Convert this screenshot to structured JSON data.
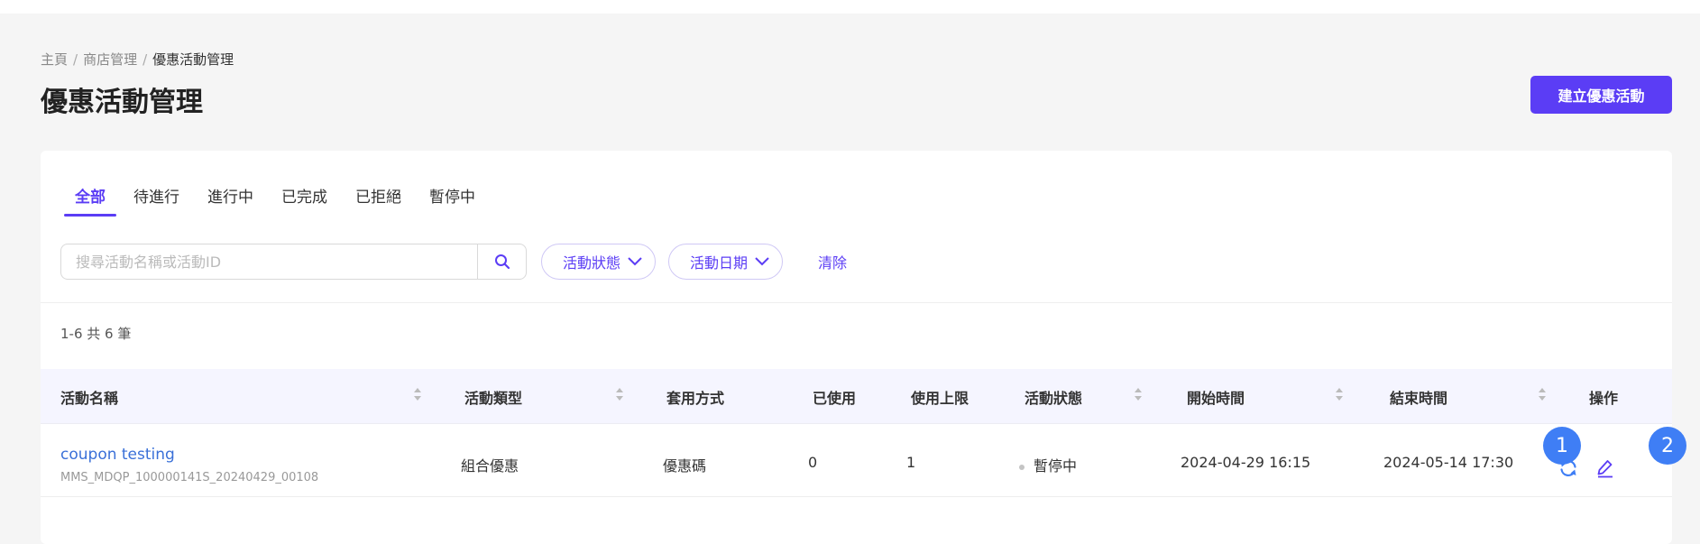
{
  "breadcrumb": {
    "items": [
      "主頁",
      "商店管理"
    ],
    "current": "優惠活動管理",
    "separator": "/"
  },
  "page": {
    "title": "優惠活動管理",
    "create_button": "建立優惠活動"
  },
  "tabs": [
    {
      "label": "全部",
      "active": true
    },
    {
      "label": "待進行",
      "active": false
    },
    {
      "label": "進行中",
      "active": false
    },
    {
      "label": "已完成",
      "active": false
    },
    {
      "label": "已拒絕",
      "active": false
    },
    {
      "label": "暫停中",
      "active": false
    }
  ],
  "filters": {
    "search_placeholder": "搜尋活動名稱或活動ID",
    "search_value": "",
    "status_filter": "活動狀態",
    "date_filter": "活動日期",
    "clear_label": "清除"
  },
  "result_count": "1-6 共 6 筆",
  "table": {
    "headers": [
      "活動名稱",
      "活動類型",
      "套用方式",
      "已使用",
      "使用上限",
      "活動狀態",
      "開始時間",
      "結束時間",
      "操作"
    ],
    "rows": [
      {
        "name": "coupon testing",
        "id": "MMS_MDQP_100000141S_20240429_00108",
        "type": "組合優惠",
        "method": "優惠碼",
        "used": "0",
        "limit": "1",
        "status": "暫停中",
        "start": "2024-04-29 16:15",
        "end": "2024-05-14 17:30"
      }
    ]
  },
  "annotations": [
    "1",
    "2"
  ],
  "colors": {
    "accent": "#5b3df5",
    "link": "#3a70d8",
    "badge": "#3f7ef5",
    "header_bg": "#f5f5ff",
    "page_bg": "#f5f5f5"
  },
  "icons": [
    "search-icon",
    "chevron-down-icon",
    "sort-icon",
    "refresh-icon",
    "edit-icon",
    "status-dot"
  ]
}
